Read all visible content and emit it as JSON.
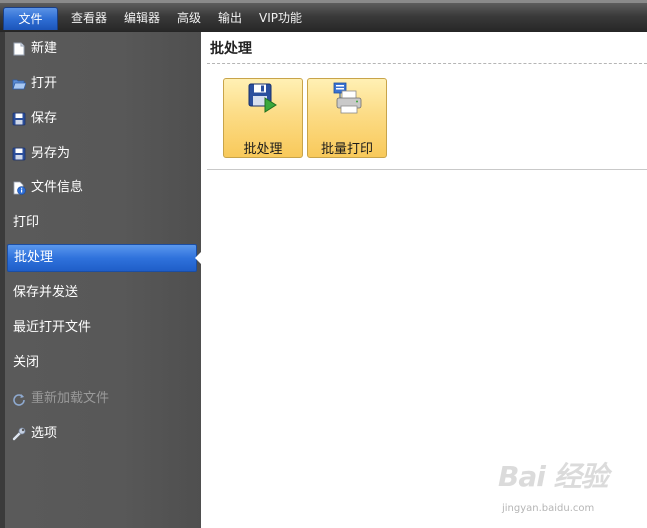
{
  "menubar": {
    "items": [
      "文件",
      "查看器",
      "编辑器",
      "高级",
      "输出",
      "VIP功能"
    ]
  },
  "sidebar": {
    "items": [
      {
        "label": "新建",
        "icon": "new-file-icon"
      },
      {
        "label": "打开",
        "icon": "open-folder-icon"
      },
      {
        "label": "保存",
        "icon": "save-disk-icon"
      },
      {
        "label": "另存为",
        "icon": "save-as-disk-icon"
      },
      {
        "label": "文件信息",
        "icon": "file-info-icon"
      },
      {
        "label": "打印",
        "icon": ""
      },
      {
        "label": "批处理",
        "icon": "",
        "active": true
      },
      {
        "label": "保存并发送",
        "icon": ""
      },
      {
        "label": "最近打开文件",
        "icon": ""
      },
      {
        "label": "关闭",
        "icon": ""
      },
      {
        "label": "重新加载文件",
        "icon": "reload-icon",
        "disabled": true
      },
      {
        "label": "选项",
        "icon": "wrench-icon"
      }
    ]
  },
  "content": {
    "title": "批处理",
    "tiles": [
      {
        "label": "批处理",
        "icon": "batch-save-icon"
      },
      {
        "label": "批量打印",
        "icon": "batch-print-icon"
      }
    ]
  },
  "watermark": {
    "logo": "Bai 经验",
    "url": "jingyan.baidu.com"
  },
  "colors": {
    "menubar_bg": "#333333",
    "sidebar_bg": "#575757",
    "active_item": "#2f72dc",
    "tile_bg": "#fcdc86",
    "tile_border": "#c8a44a"
  }
}
